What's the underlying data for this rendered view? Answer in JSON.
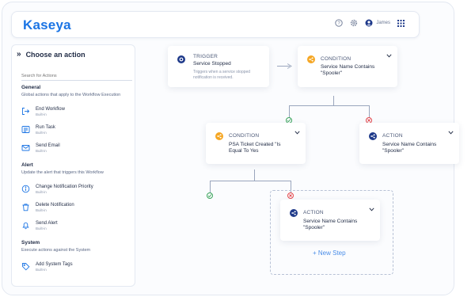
{
  "header": {
    "logo": "Kaseya",
    "user_name": "James"
  },
  "sidebar": {
    "title": "Choose an action",
    "search_placeholder": "Search for Actions",
    "sections": [
      {
        "heading": "General",
        "description": "Global actions that apply to the Workflow Execution",
        "items": [
          {
            "name": "End Workflow",
            "tag": "Built-in",
            "icon": "exit-icon"
          },
          {
            "name": "Run Task",
            "tag": "Built-in",
            "icon": "task-list-icon"
          },
          {
            "name": "Send Email",
            "tag": "Built-in",
            "icon": "envelope-icon"
          }
        ]
      },
      {
        "heading": "Alert",
        "description": "Update the alert that triggers this Workflow",
        "items": [
          {
            "name": "Change Notification Priority",
            "tag": "Built-in",
            "icon": "info-circle-icon"
          },
          {
            "name": "Delete Notification",
            "tag": "Built-in",
            "icon": "trash-icon"
          },
          {
            "name": "Send Alert",
            "tag": "Built-in",
            "icon": "bell-icon"
          }
        ]
      },
      {
        "heading": "System",
        "description": "Execute actions against the System",
        "items": [
          {
            "name": "Add System Tags",
            "tag": "Built-in",
            "icon": "tag-icon"
          }
        ]
      }
    ]
  },
  "canvas": {
    "trigger": {
      "label": "TRIGGER",
      "value": "Service Stopped",
      "description_line1": "Triggers when a service stopped",
      "description_line2": "notification is received."
    },
    "condition1": {
      "label": "CONDITION",
      "value_line1": "Service Name Contains",
      "value_line2": "\"Spooler\""
    },
    "condition2": {
      "label": "CONDITION",
      "value_line1": "PSA Ticket Created \"Is",
      "value_line2": "Equal To Yes"
    },
    "action1": {
      "label": "ACTION",
      "value_line1": "Service Name Contains",
      "value_line2": "\"Spooler\""
    },
    "action2": {
      "label": "ACTION",
      "value_line1": "Service Name Contains",
      "value_line2": "\"Spooler\""
    },
    "new_step": "+ New Step"
  },
  "colors": {
    "brand": "#1b74e4",
    "condition_icon": "#f5a623",
    "action_icon": "#1f3a8a",
    "trigger_icon": "#1f3a8a",
    "yes": "#3ba55c",
    "no": "#e5484d",
    "new_step": "#4a8de8"
  }
}
